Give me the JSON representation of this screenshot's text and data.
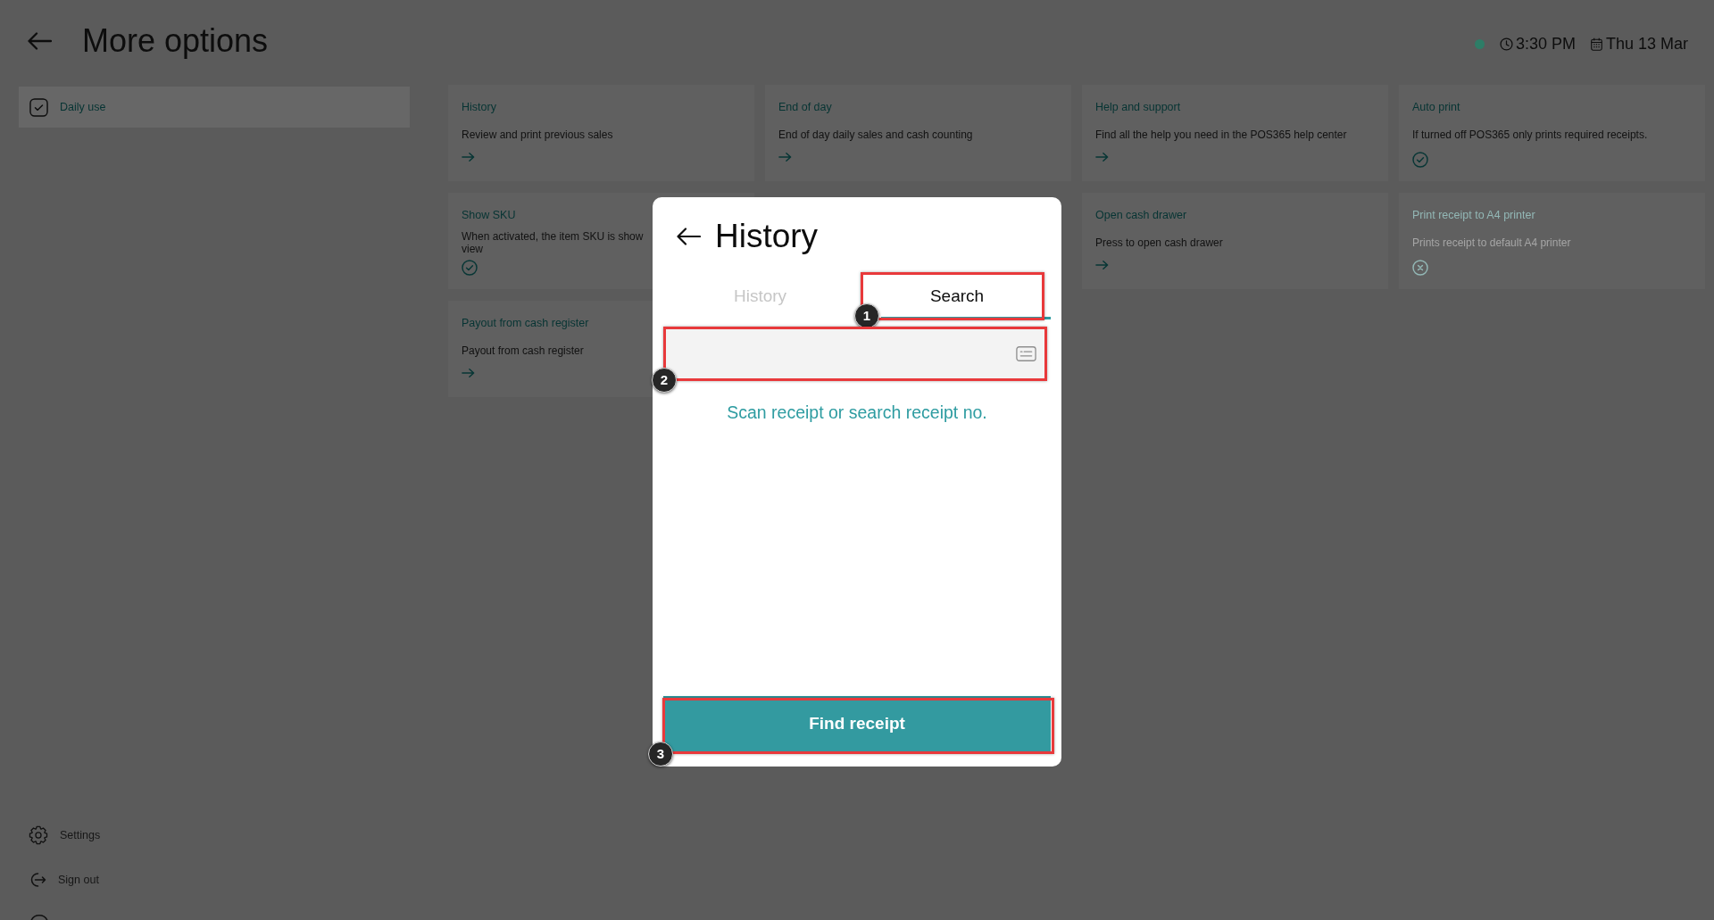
{
  "header": {
    "title": "More options",
    "online": true,
    "time": "3:30 PM",
    "date": "Thu 13 Mar"
  },
  "sidebar": {
    "items": [
      {
        "label": "Daily use",
        "selected": true
      }
    ],
    "footer_items": [
      {
        "label": "Settings",
        "kind": "settings"
      },
      {
        "label": "Sign out",
        "kind": "sign_out"
      }
    ]
  },
  "cards": [
    {
      "title": "History",
      "description": "Review and print previous sales",
      "kind": "link",
      "disabled": false
    },
    {
      "title": "End of day",
      "description": "End of day daily sales and cash counting",
      "kind": "link",
      "disabled": false
    },
    {
      "title": "Help and support",
      "description": "Find all the help you need in the POS365 help center",
      "kind": "link",
      "disabled": false
    },
    {
      "title": "Auto print",
      "description": "If turned off POS365 only prints required receipts.",
      "kind": "toggle",
      "on": true,
      "disabled": false
    },
    {
      "title": "Show SKU",
      "description": "When activated, the item SKU is show\nview",
      "kind": "toggle",
      "on": true,
      "disabled": false
    },
    {
      "title": "Open cash drawer",
      "description": "Press to open cash drawer",
      "kind": "link",
      "disabled": false
    },
    {
      "title": "Print receipt to A4 printer",
      "description": "Prints receipt to default A4 printer",
      "kind": "toggle",
      "on": false,
      "disabled": true
    },
    {
      "title": "Payout from cash register",
      "description": "Payout from cash register",
      "kind": "link",
      "disabled": false
    }
  ],
  "dialog": {
    "title": "History",
    "tabs": [
      {
        "label": "History",
        "selected": false
      },
      {
        "label": "Search",
        "selected": true,
        "annotation": "1"
      }
    ],
    "search_field": {
      "annotation": "2"
    },
    "hint": "Scan receipt or search receipt no.",
    "button": {
      "label": "Find receipt",
      "annotation": "3"
    }
  }
}
